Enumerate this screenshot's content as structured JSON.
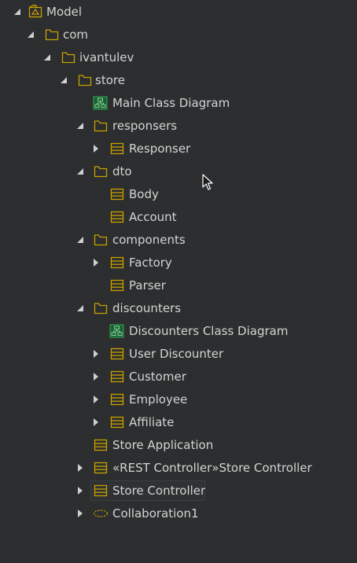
{
  "tree": {
    "items": [
      {
        "label": "Model",
        "icon": "model-package-icon",
        "toggle": "expanded"
      },
      {
        "label": "com",
        "icon": "folder-icon",
        "toggle": "expanded"
      },
      {
        "label": "ivantulev",
        "icon": "folder-icon",
        "toggle": "expanded"
      },
      {
        "label": "store",
        "icon": "folder-icon",
        "toggle": "expanded"
      },
      {
        "label": "Main Class Diagram",
        "icon": "class-diagram-icon",
        "toggle": "none"
      },
      {
        "label": "responsers",
        "icon": "folder-icon",
        "toggle": "expanded"
      },
      {
        "label": "Responser",
        "icon": "class-icon",
        "toggle": "collapsed"
      },
      {
        "label": "dto",
        "icon": "folder-icon",
        "toggle": "expanded"
      },
      {
        "label": "Body",
        "icon": "class-icon",
        "toggle": "none"
      },
      {
        "label": "Account",
        "icon": "class-icon",
        "toggle": "none"
      },
      {
        "label": "components",
        "icon": "folder-icon",
        "toggle": "expanded"
      },
      {
        "label": "Factory",
        "icon": "class-icon",
        "toggle": "collapsed"
      },
      {
        "label": "Parser",
        "icon": "class-icon",
        "toggle": "none"
      },
      {
        "label": "discounters",
        "icon": "folder-icon",
        "toggle": "expanded"
      },
      {
        "label": "Discounters Class Diagram",
        "icon": "class-diagram-icon",
        "toggle": "none"
      },
      {
        "label": "User Discounter",
        "icon": "class-icon",
        "toggle": "collapsed"
      },
      {
        "label": "Customer",
        "icon": "class-icon",
        "toggle": "collapsed"
      },
      {
        "label": "Employee",
        "icon": "class-icon",
        "toggle": "collapsed"
      },
      {
        "label": "Affiliate",
        "icon": "class-icon",
        "toggle": "collapsed"
      },
      {
        "label": "Store Application",
        "icon": "class-icon",
        "toggle": "none"
      },
      {
        "label": "«REST Controller»Store Controller",
        "icon": "class-icon",
        "toggle": "collapsed"
      },
      {
        "label": "Store Controller",
        "icon": "class-icon",
        "toggle": "collapsed"
      },
      {
        "label": "Collaboration1",
        "icon": "collaboration-icon",
        "toggle": "collapsed"
      }
    ]
  },
  "colors": {
    "background": "#2b2d2e",
    "text": "#d4d4d4",
    "folder": "#c8a000",
    "class": "#c8a000",
    "diagram": "#2e9a4a"
  }
}
